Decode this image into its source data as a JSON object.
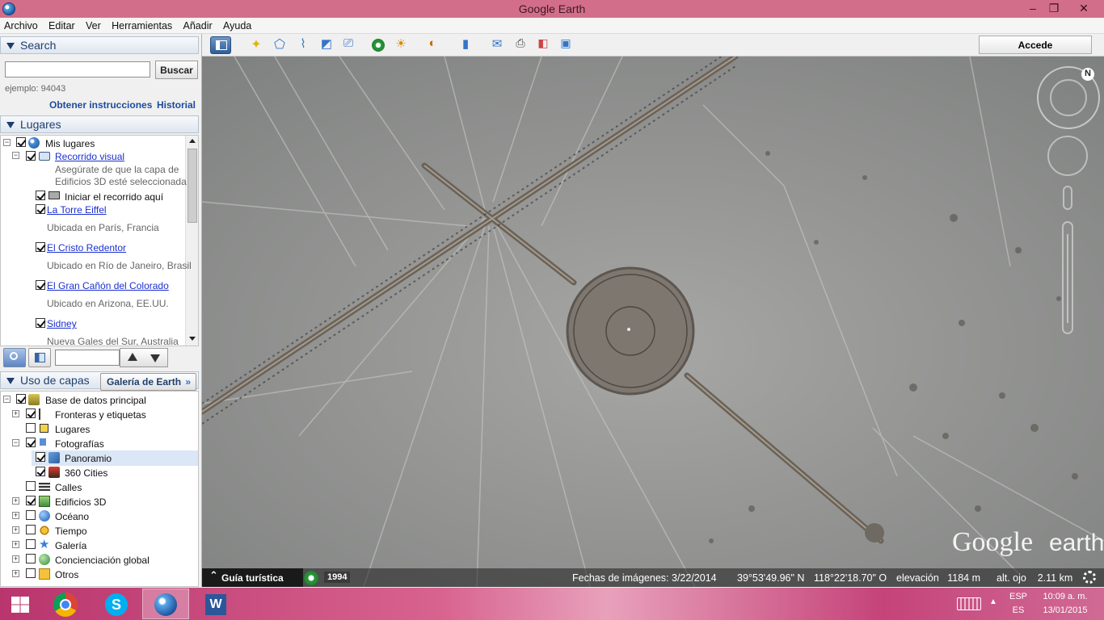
{
  "window": {
    "title": "Google Earth",
    "minimize": "–",
    "maximize": "❐",
    "close": "✕"
  },
  "menu": [
    "Archivo",
    "Editar",
    "Ver",
    "Herramientas",
    "Añadir",
    "Ayuda"
  ],
  "search": {
    "header": "Search",
    "button": "Buscar",
    "placeholder": "",
    "hint": "ejemplo: 94043",
    "directions_link": "Obtener instrucciones",
    "history_link": "Historial"
  },
  "places": {
    "header": "Lugares",
    "my_places": "Mis lugares",
    "tour": "Recorrido visual",
    "tour_desc_1": "Asegúrate de que la capa de",
    "tour_desc_2": "Edificios 3D esté seleccionada",
    "start_tour": "Iniciar el recorrido aquí",
    "items": [
      {
        "name": "La Torre Eiffel",
        "desc": "Ubicada en París, Francia"
      },
      {
        "name": "El Cristo Redentor",
        "desc": "Ubicado en Río de Janeiro, Brasil"
      },
      {
        "name": "El Gran Cañón del Colorado",
        "desc": "Ubicado en Arizona, EE.UU."
      },
      {
        "name": "Sidney",
        "desc": "Nueva Gales del Sur, Australia"
      }
    ]
  },
  "layers": {
    "header": "Uso de capas",
    "gallery_button": "Galería de Earth",
    "gallery_chevron": "»",
    "items": [
      {
        "label": "Base de datos principal"
      },
      {
        "label": "Fronteras y etiquetas"
      },
      {
        "label": "Lugares"
      },
      {
        "label": "Fotografías"
      },
      {
        "label": "Panoramio"
      },
      {
        "label": "360 Cities"
      },
      {
        "label": "Calles"
      },
      {
        "label": "Edificios 3D"
      },
      {
        "label": "Océano"
      },
      {
        "label": "Tiempo"
      },
      {
        "label": "Galería"
      },
      {
        "label": "Concienciación global"
      },
      {
        "label": "Otros"
      }
    ]
  },
  "toolbar": {
    "sign_in": "Accede"
  },
  "map": {
    "watermark_google": "Google",
    "watermark_earth": "earth",
    "tour_guide": "Guía turística",
    "year": "1994",
    "imagery_date": "Fechas de imágenes: 3/22/2014",
    "lat": "39°53'49.96\" N",
    "lon": "118°22'18.70\" O",
    "elevation": "elevación   1184 m",
    "eye_alt": "alt. ojo    2.11 km"
  },
  "taskbar": {
    "lang_1": "ESP",
    "lang_2": "ES",
    "time": "10:09 a. m.",
    "date": "13/01/2015"
  },
  "colors": {
    "accent": "#1e3f6e",
    "titlebar": "#d36e8a",
    "link": "#1a2fd0"
  }
}
